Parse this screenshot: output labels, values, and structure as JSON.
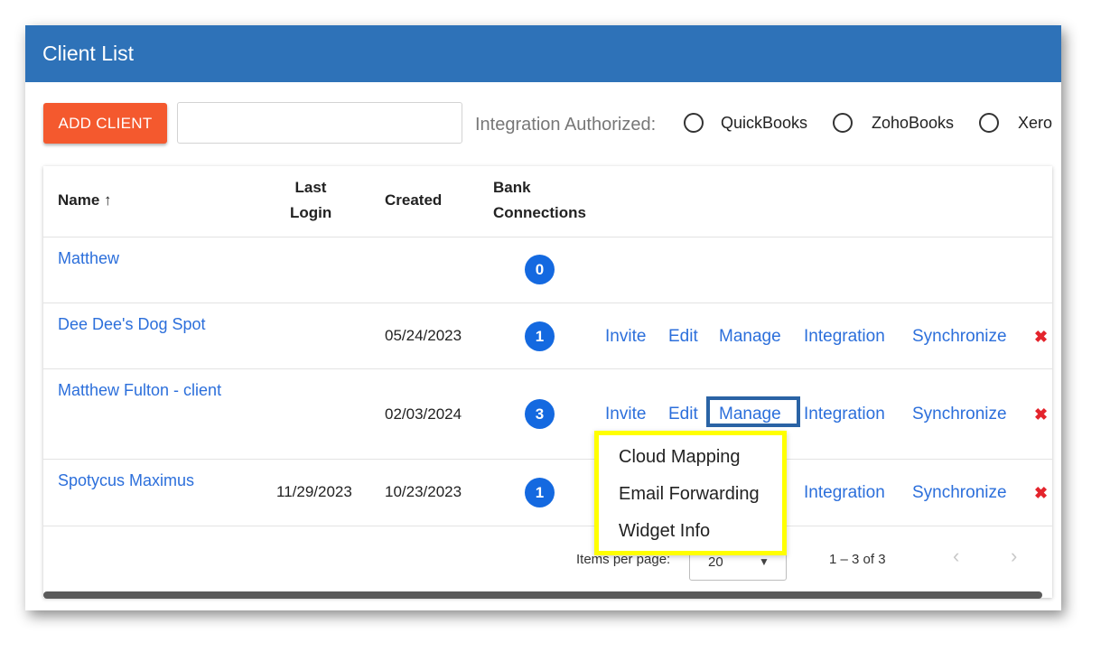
{
  "title": "Client List",
  "toolbar": {
    "add_client_label": "ADD CLIENT",
    "search_value": "",
    "integration_label": "Integration Authorized:",
    "options": [
      "QuickBooks",
      "ZohoBooks",
      "Xero"
    ]
  },
  "table": {
    "headers": {
      "name": "Name",
      "sort_arrow": "↑",
      "last_login_1": "Last",
      "last_login_2": "Login",
      "created": "Created",
      "bank_1": "Bank",
      "bank_2": "Connections"
    },
    "rows": [
      {
        "name": "Matthew",
        "last_login": "",
        "created": "",
        "bank": "0"
      },
      {
        "name": "Dee Dee's Dog Spot",
        "last_login": "",
        "created": "05/24/2023",
        "bank": "1"
      },
      {
        "name": "Matthew Fulton - client",
        "last_login": "",
        "created": "02/03/2024",
        "bank": "3"
      },
      {
        "name": "Spotycus Maximus",
        "last_login": "11/29/2023",
        "created": "10/23/2023",
        "bank": "1"
      }
    ],
    "actions": {
      "invite": "Invite",
      "edit": "Edit",
      "manage": "Manage",
      "integration": "Integration",
      "synchronize": "Synchronize",
      "delete": "✖"
    }
  },
  "manage_menu": {
    "items": [
      "Cloud Mapping",
      "Email Forwarding",
      "Widget Info"
    ]
  },
  "footer": {
    "items_per_page_label": "Items per page:",
    "items_per_page_value": "20",
    "range": "1 – 3 of 3",
    "prev": "‹",
    "next": "›"
  },
  "colors": {
    "titlebar": "#2e72b8",
    "add_button": "#f4592e",
    "link": "#2c6fdb",
    "badge": "#1469e0",
    "delete": "#e4242c",
    "highlight_manage": "#2a63a5",
    "highlight_menu": "#ffff00"
  }
}
